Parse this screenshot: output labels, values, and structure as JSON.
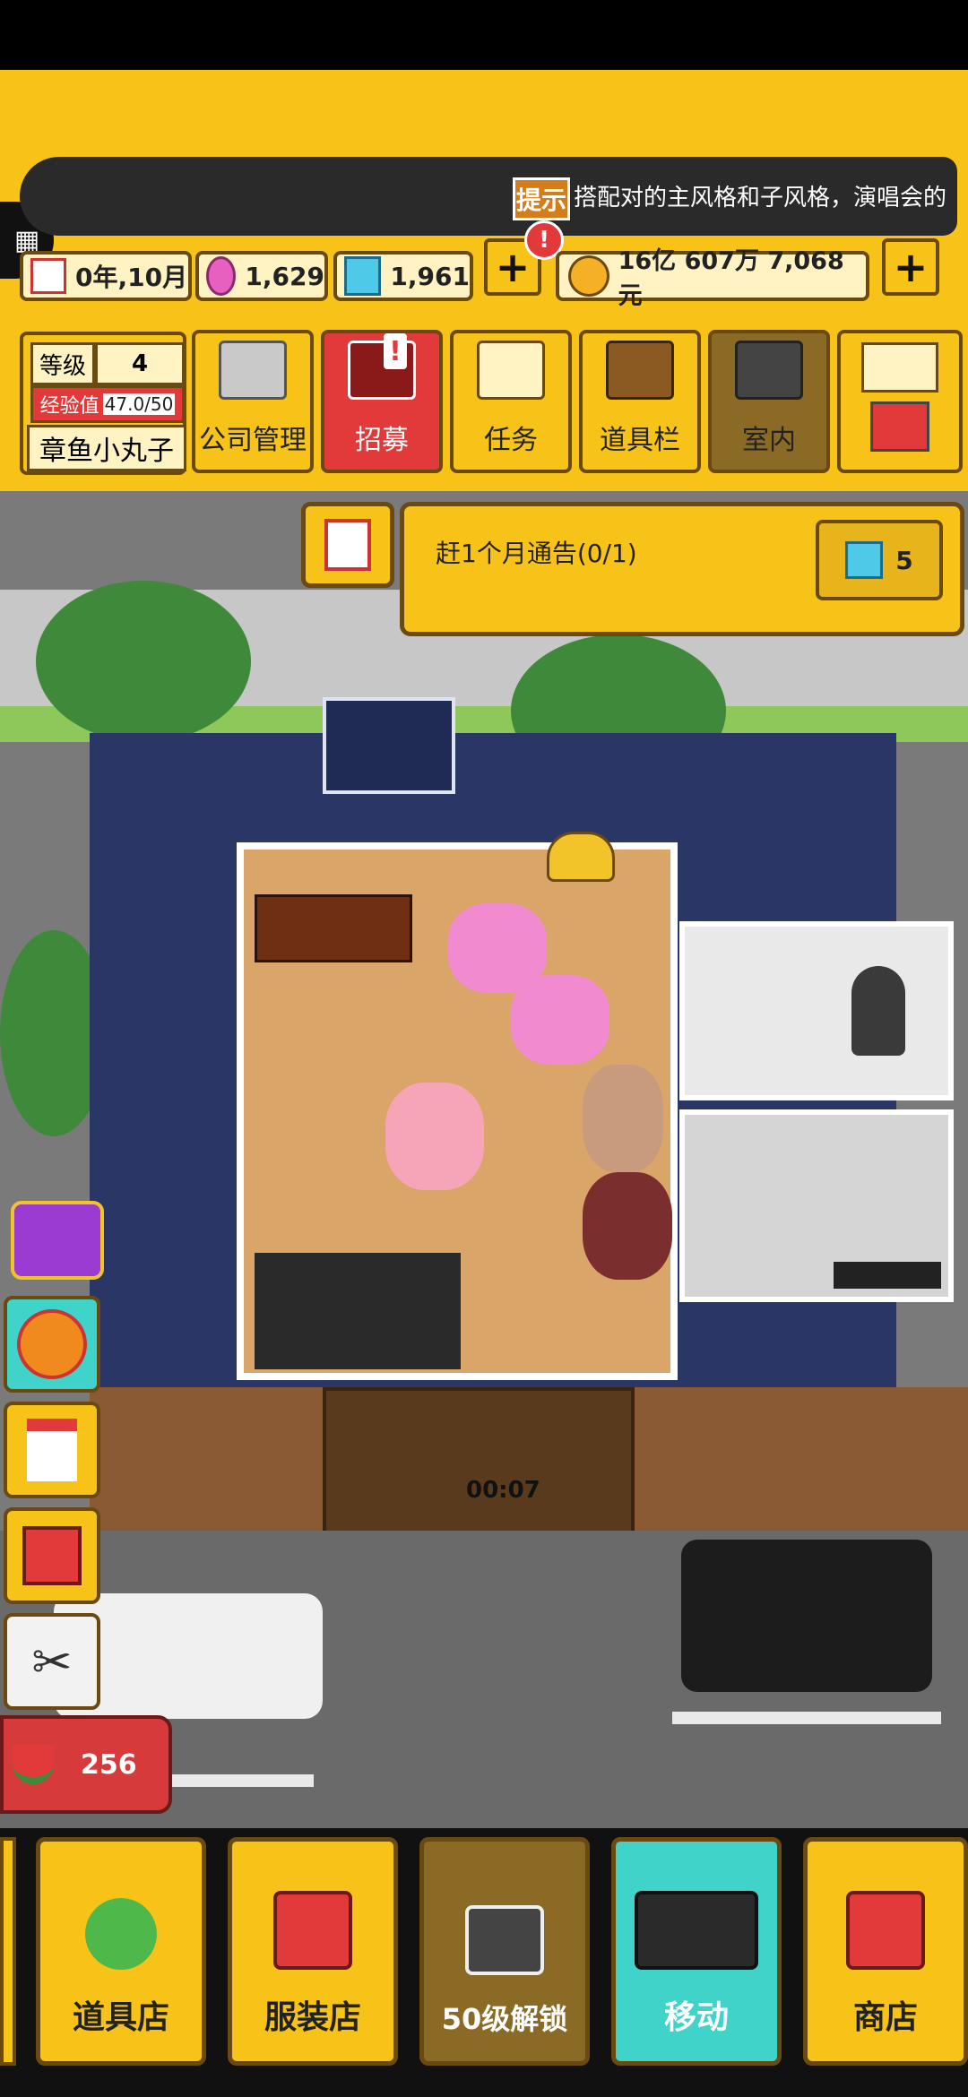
{
  "ticker": {
    "badge": "提示",
    "text": "搭配对的主风格和子风格，演唱会的"
  },
  "hud": {
    "date": "0年,10月",
    "pink_gems": "1,629",
    "blue_gems": "1,961",
    "money": "16亿 607万 7,068元",
    "plus": "+",
    "alert": "!"
  },
  "player": {
    "level_label": "等级",
    "level": "4",
    "exp_label": "经验值",
    "exp": "47.0/50",
    "name": "章鱼小丸子"
  },
  "menu": [
    {
      "label": "公司管理",
      "icon": "building-icon"
    },
    {
      "label": "招募",
      "icon": "recruit-icon"
    },
    {
      "label": "任务",
      "icon": "scroll-icon"
    },
    {
      "label": "道具栏",
      "icon": "chest-icon"
    },
    {
      "label": "室内",
      "icon": "paint-roller-icon"
    },
    {
      "label": "",
      "icon": "mail-hammer-icon"
    }
  ],
  "quest": {
    "text": "赶1个月通告(0/1)",
    "reward": "5"
  },
  "timer": "00:07",
  "watermelon_count": "256",
  "shops": [
    {
      "label": "道具店",
      "icon": "clover-icon"
    },
    {
      "label": "服装店",
      "icon": "shirt-icon"
    },
    {
      "label": "50级解锁",
      "icon": "camera-icon"
    },
    {
      "label": "移动",
      "icon": "van-icon"
    },
    {
      "label": "商店",
      "icon": "store-icon"
    }
  ],
  "colors": {
    "accent": "#f7c319",
    "recruit": "#e23a3a",
    "move": "#3fd3c9",
    "wood": "#6b4a12"
  }
}
